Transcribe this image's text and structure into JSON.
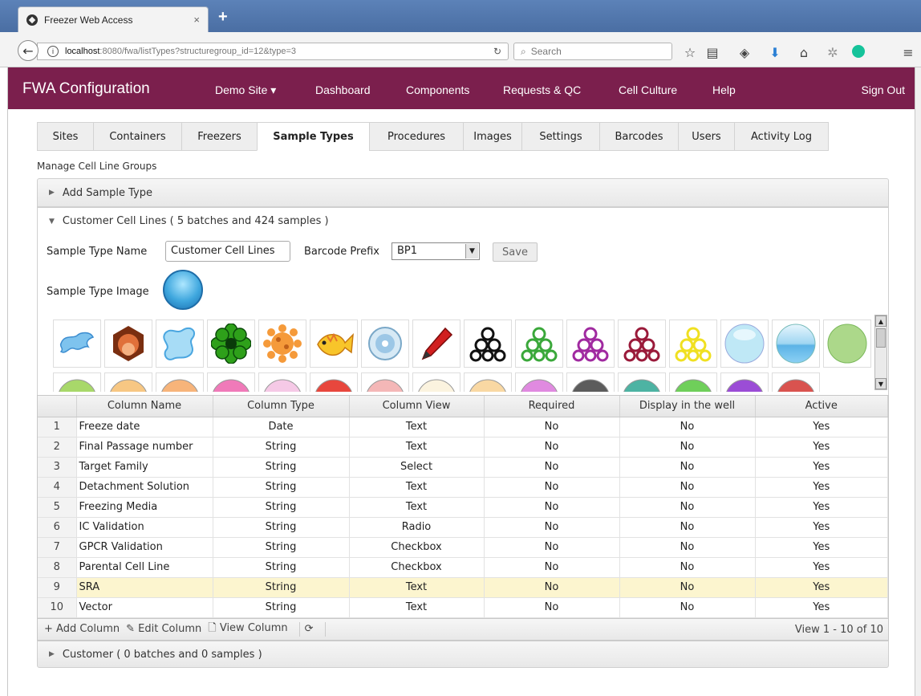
{
  "browser": {
    "tab_title": "Freezer Web Access",
    "tab_close": "×",
    "new_tab": "+",
    "url_host": "localhost",
    "url_path": ":8080/fwa/listTypes?structuregroup_id=12&type=3",
    "search_placeholder": "Search"
  },
  "app": {
    "brand": "FWA Configuration",
    "menu": [
      "Demo Site ▾",
      "Dashboard",
      "Components",
      "Requests & QC",
      "Cell Culture",
      "Help"
    ],
    "sign_out": "Sign Out"
  },
  "tabs": [
    "Sites",
    "Containers",
    "Freezers",
    "Sample Types",
    "Procedures",
    "Images",
    "Settings",
    "Barcodes",
    "Users",
    "Activity Log"
  ],
  "active_tab": "Sample Types",
  "page_label": "Manage Cell Line Groups",
  "accordion": {
    "add": "Add Sample Type",
    "current": "Customer Cell Lines ( 5 batches and 424 samples )",
    "other": "Customer ( 0 batches and 0 samples )"
  },
  "form": {
    "name_label": "Sample Type Name",
    "name_value": "Customer Cell Lines",
    "prefix_label": "Barcode Prefix",
    "prefix_value": "BP1",
    "save": "Save",
    "image_label": "Sample Type Image"
  },
  "icons_row1": [
    "splash-blue-icon",
    "orange-hex-icon",
    "splat-blue-icon",
    "green-flower-icon",
    "orange-gear-icon",
    "fish-icon",
    "blue-disc-icon",
    "pen-icon",
    "triangle-circles-black-icon",
    "triangle-circles-green-icon",
    "triangle-circles-purple-icon",
    "triangle-circles-maroon-icon",
    "triangle-circles-yellow-icon",
    "light-blue-circle-icon",
    "blue-gradient-circle-icon",
    "green-circle-icon"
  ],
  "icons_row2_colors": [
    "#a8d86a",
    "#f7c783",
    "#f7b47a",
    "#f07ab9",
    "#f5c9e6",
    "#e8473d",
    "#f4b7b7",
    "#fbf3df",
    "#f9d8a3",
    "#e08ae0",
    "#5c5c5c",
    "#4db3a3",
    "#6fcf5a",
    "#9b4dd6",
    "#d9534f"
  ],
  "grid": {
    "columns": [
      "Column Name",
      "Column Type",
      "Column View",
      "Required",
      "Display in the well",
      "Active"
    ],
    "rows": [
      [
        "1",
        "Freeze date",
        "Date",
        "Text",
        "No",
        "No",
        "Yes"
      ],
      [
        "2",
        "Final Passage number",
        "String",
        "Text",
        "No",
        "No",
        "Yes"
      ],
      [
        "3",
        "Target Family",
        "String",
        "Select",
        "No",
        "No",
        "Yes"
      ],
      [
        "4",
        "Detachment Solution",
        "String",
        "Text",
        "No",
        "No",
        "Yes"
      ],
      [
        "5",
        "Freezing Media",
        "String",
        "Text",
        "No",
        "No",
        "Yes"
      ],
      [
        "6",
        "IC Validation",
        "String",
        "Radio",
        "No",
        "No",
        "Yes"
      ],
      [
        "7",
        "GPCR Validation",
        "String",
        "Checkbox",
        "No",
        "No",
        "Yes"
      ],
      [
        "8",
        "Parental Cell Line",
        "String",
        "Checkbox",
        "No",
        "No",
        "Yes"
      ],
      [
        "9",
        "SRA",
        "String",
        "Text",
        "No",
        "No",
        "Yes"
      ],
      [
        "10",
        "Vector",
        "String",
        "Text",
        "No",
        "No",
        "Yes"
      ]
    ],
    "highlight_row": 9,
    "pager": {
      "add": "+ Add Column",
      "edit": "✎ Edit Column",
      "view": "🗋 View Column",
      "refresh": "⟳",
      "info": "View 1 - 10 of 10"
    }
  }
}
